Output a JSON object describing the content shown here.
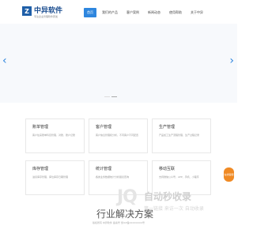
{
  "brand": {
    "mark": "Z",
    "name": "中异软件",
    "tagline": "专注企业管理软件研发"
  },
  "nav": [
    "首页",
    "我们的产品",
    "客户案例",
    "新闻动态",
    "使用帮助",
    "关于中异"
  ],
  "banner": {
    "prev": "‹",
    "next": "›"
  },
  "cards": [
    {
      "title": "账单管理",
      "desc": "客户往来账单科目管理、对账、账户记账"
    },
    {
      "title": "客户管理",
      "desc": "客户信息管理和分析，不同客户不同配置"
    },
    {
      "title": "生产管理",
      "desc": "产品加工生产流程管理、生产过程记录"
    },
    {
      "title": "库存管理",
      "desc": "进货库存管理、库位库存日期管理"
    },
    {
      "title": "统计管理",
      "desc": "各类业务数据统计分析报表查询"
    },
    {
      "title": "移动互联",
      "desc": "支持微信公众号、APP、手机、小程序"
    }
  ],
  "float_btn": "在线客服",
  "watermark": {
    "logo": "JQ",
    "title": "自动秒收录",
    "sub": "第一链接 来访一次 自动收录"
  },
  "bigtext": "行业解决方案",
  "footer": "版权所有 中异软件 备案号 浙ICP备XXXXXXXX号"
}
